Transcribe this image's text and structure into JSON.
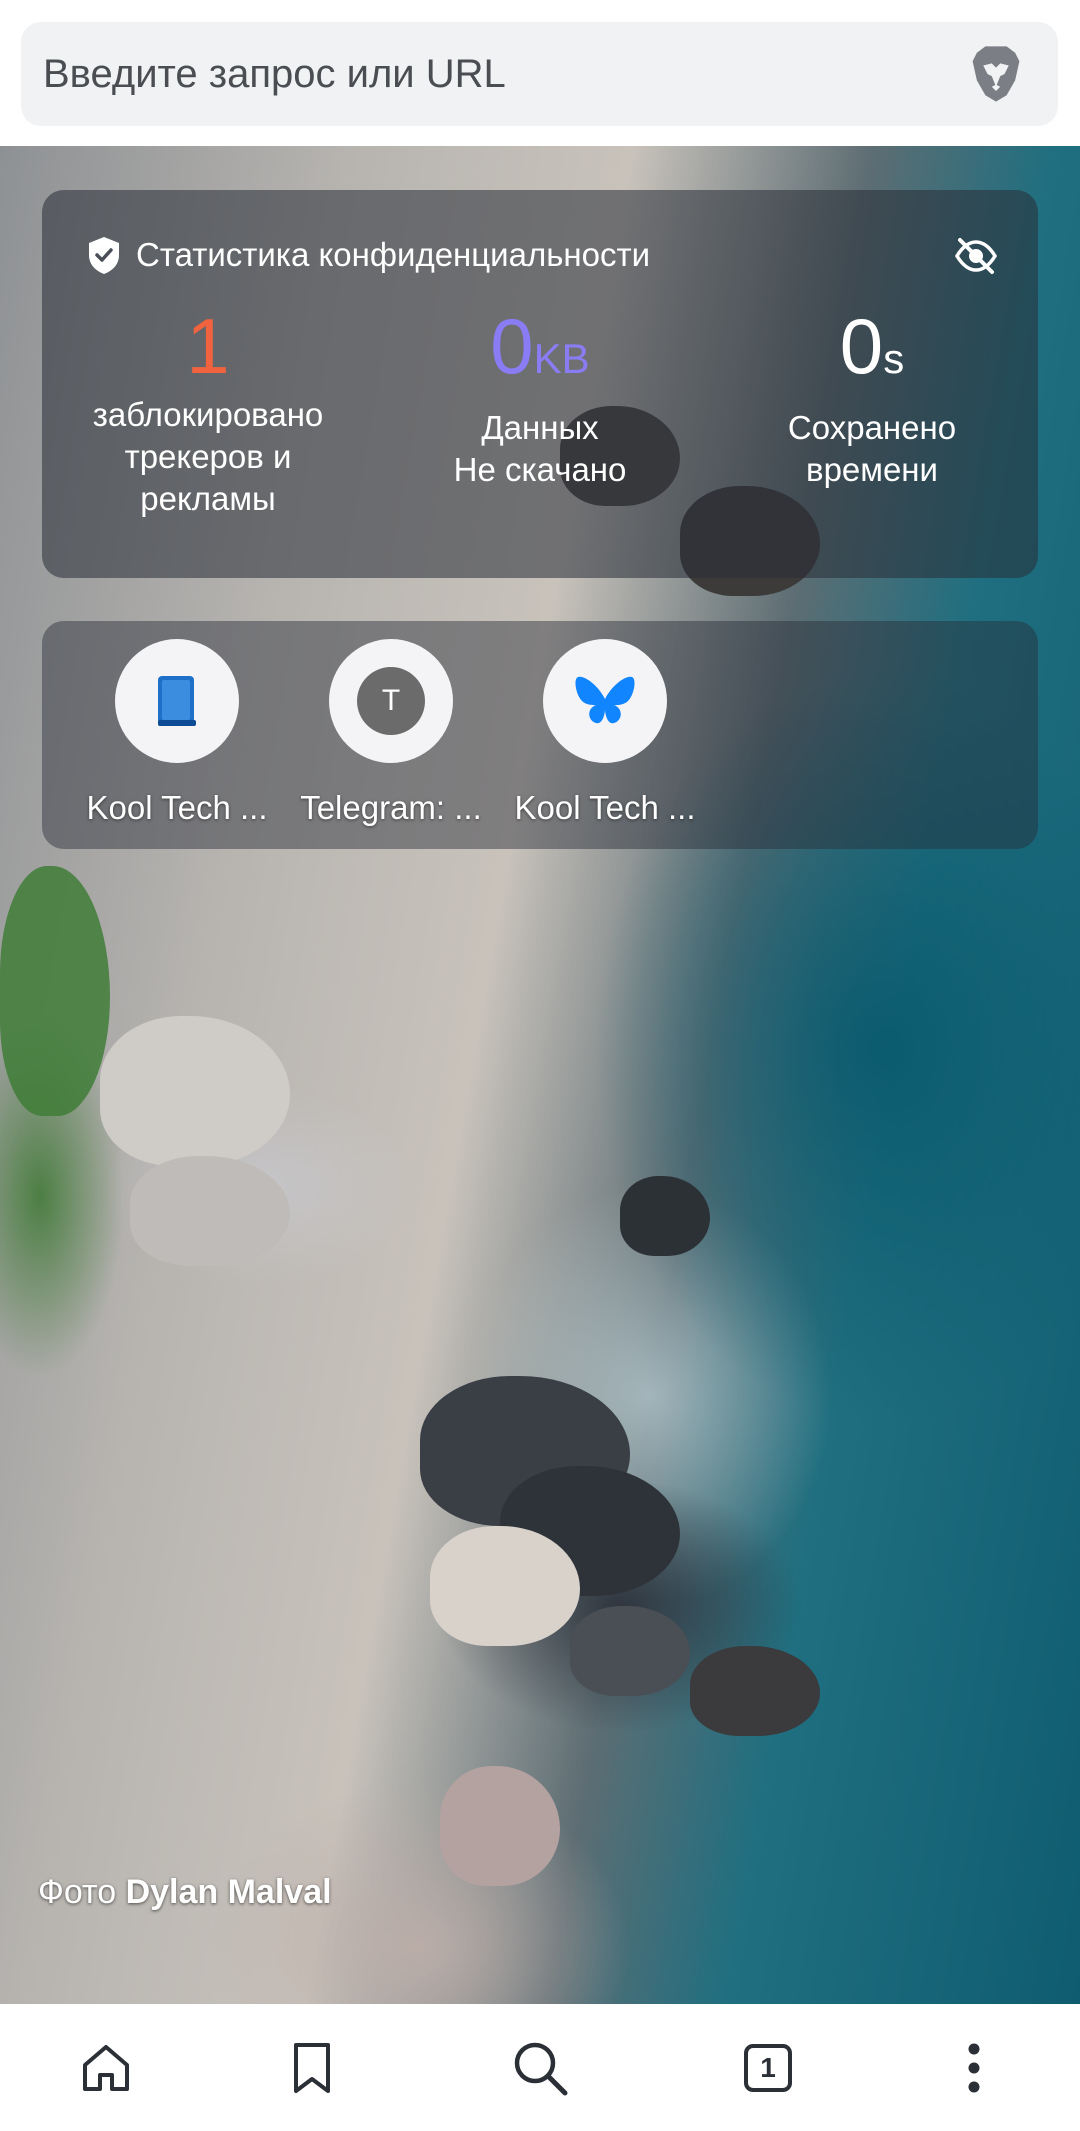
{
  "address_bar": {
    "placeholder": "Введите запрос или URL",
    "brave_icon": "brave-lion-icon"
  },
  "privacy_stats": {
    "title": "Статистика конфиденциальности",
    "trackers": {
      "value": "1",
      "label": "заблокировано трекеров и рекламы",
      "color": "#f0633e"
    },
    "data": {
      "value": "0",
      "unit": "KB",
      "label_line1": "Данных",
      "label_line2": "Не скачано",
      "color": "#8a7cf5"
    },
    "time": {
      "value": "0",
      "unit": "s",
      "label_line1": "Сохранено",
      "label_line2": "времени",
      "color": "#ffffff"
    }
  },
  "top_sites": [
    {
      "label": "Kool Tech ...",
      "icon": "book-icon"
    },
    {
      "label": "Telegram: ...",
      "icon": "letter-t-icon",
      "letter": "T"
    },
    {
      "label": "Kool Tech ...",
      "icon": "butterfly-icon"
    }
  ],
  "photo_credit": {
    "prefix": "Фото",
    "author": "Dylan Malval"
  },
  "bottom_bar": {
    "tab_count": "1",
    "icons": [
      "home-icon",
      "bookmark-icon",
      "search-icon",
      "tabs-icon",
      "more-vertical-icon"
    ]
  }
}
